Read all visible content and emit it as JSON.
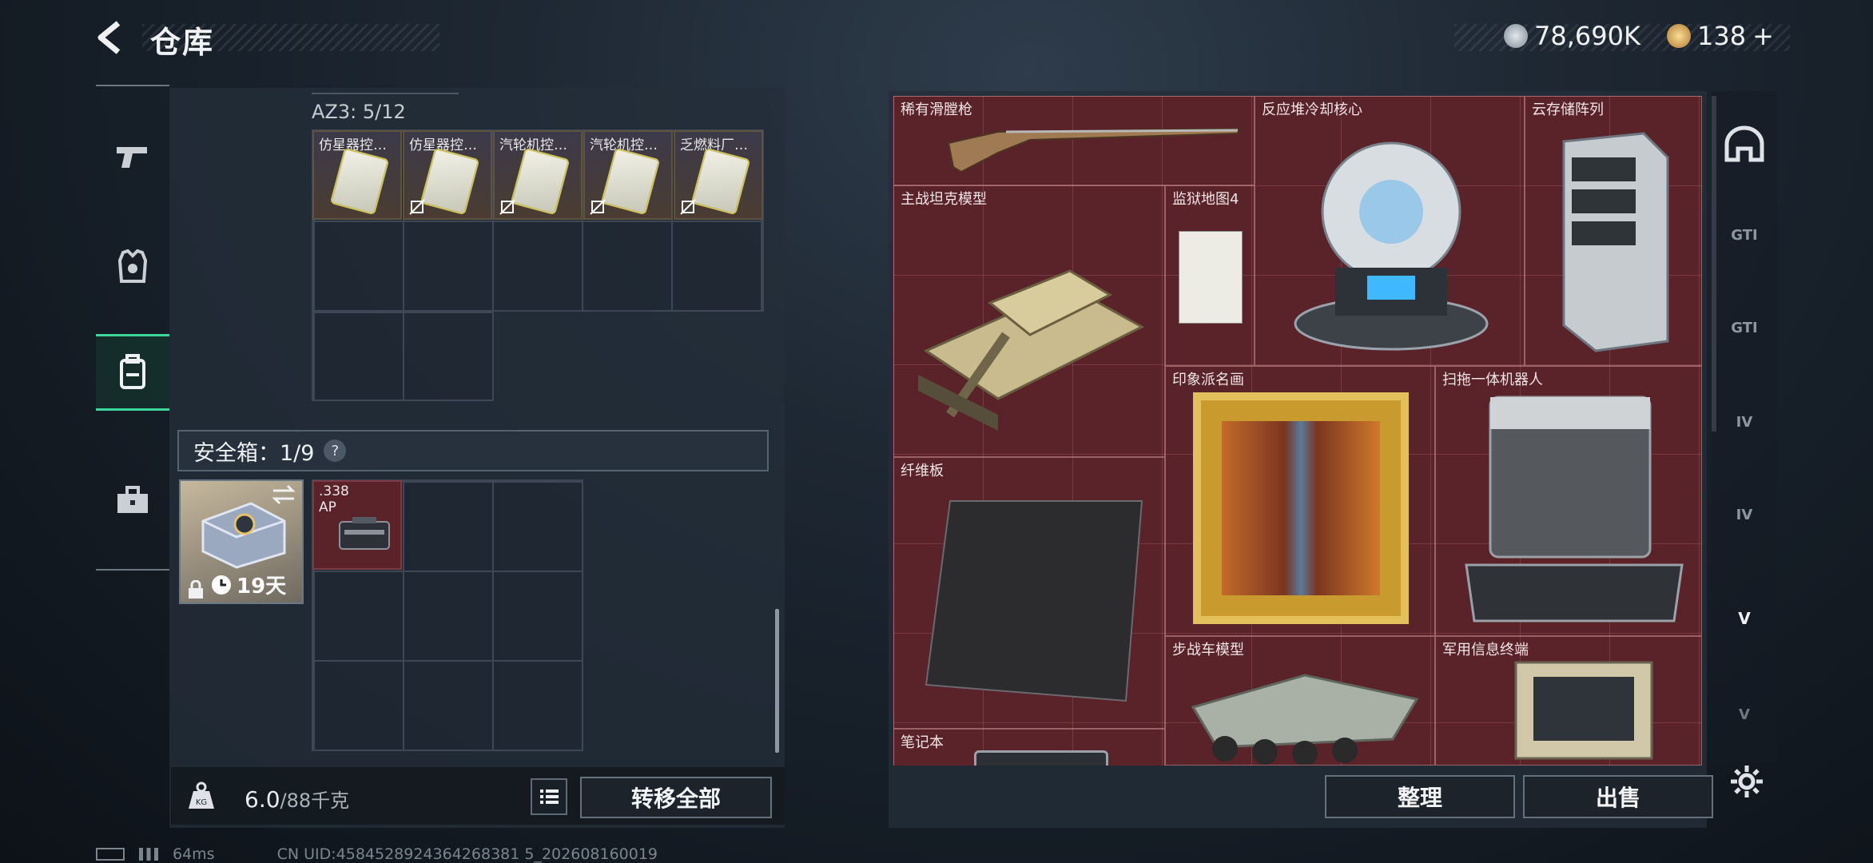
{
  "header": {
    "title": "仓库",
    "back_icon": "back-arrow-icon"
  },
  "currency": [
    {
      "icon": "silver-coin-icon",
      "value": "78,690K",
      "color": "#b8c2cc"
    },
    {
      "icon": "gold-coin-icon",
      "value": "138",
      "plus": "+",
      "color": "#d4a24a"
    }
  ],
  "left_nav": [
    {
      "icon": "pistol-icon",
      "active": false
    },
    {
      "icon": "armor-vest-icon",
      "active": false
    },
    {
      "icon": "backpack-icon",
      "active": true
    },
    {
      "icon": "toolbox-icon",
      "active": false
    }
  ],
  "container": {
    "label": "AZ3: 5/12",
    "items": [
      {
        "name": "仿星器控…",
        "no_bind": false
      },
      {
        "name": "仿星器控…",
        "no_bind": true
      },
      {
        "name": "汽轮机控…",
        "no_bind": true
      },
      {
        "name": "汽轮机控…",
        "no_bind": true
      },
      {
        "name": "乏燃料厂…",
        "no_bind": true
      }
    ]
  },
  "safe_box": {
    "label": "安全箱：1/9",
    "help": "?",
    "timer": "19天",
    "item": {
      "name": ".338\nAP"
    }
  },
  "weight": {
    "value": "6.0",
    "max": "/88千克"
  },
  "buttons": {
    "transfer_all": "转移全部",
    "organize": "整理",
    "sell": "出售"
  },
  "stash_items": [
    {
      "name": "稀有滑膛枪"
    },
    {
      "name": "反应堆冷却核心"
    },
    {
      "name": "云存储阵列"
    },
    {
      "name": "主战坦克模型"
    },
    {
      "name": "监狱地图4"
    },
    {
      "name": "印象派名画"
    },
    {
      "name": "扫拖一体机器人"
    },
    {
      "name": "纤维板"
    },
    {
      "name": "步战车模型"
    },
    {
      "name": "军用信息终端"
    },
    {
      "name": "笔记本"
    }
  ],
  "right_nav": [
    {
      "icon": "helmet-icon",
      "label": ""
    },
    {
      "icon": "gti-weapon-icon",
      "label": "GTI"
    },
    {
      "icon": "gti-armor-icon",
      "label": "GTI"
    },
    {
      "icon": "iv-item-icon",
      "label": "IV"
    },
    {
      "icon": "iv-box-icon",
      "label": "IV"
    },
    {
      "icon": "v-case-icon",
      "label": "V"
    },
    {
      "icon": "v-case2-icon",
      "label": "V"
    }
  ],
  "status_bar": {
    "ping": "64ms",
    "uid": "CN UID:4584528924364268381 5_202608160019"
  }
}
